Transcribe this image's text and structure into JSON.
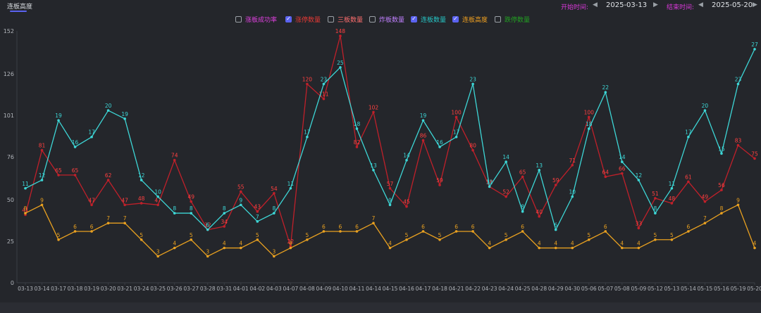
{
  "header": {
    "tab_label": "连板高度",
    "start_label": "开始时间:",
    "start_date": "2025-03-13",
    "end_label": "结束时间:",
    "end_date": "2025-05-20",
    "prev_icon": "caret-left-icon",
    "next_icon": "caret-right-icon"
  },
  "legend": [
    {
      "label": "涨板成功率",
      "checked": false,
      "color": "#e040e0"
    },
    {
      "label": "涨停数量",
      "checked": true,
      "color": "#e53935"
    },
    {
      "label": "三板数量",
      "checked": false,
      "color": "#ff6e6e"
    },
    {
      "label": "炸板数量",
      "checked": false,
      "color": "#c080ff"
    },
    {
      "label": "连板数量",
      "checked": true,
      "color": "#26c6c6"
    },
    {
      "label": "连板高度",
      "checked": true,
      "color": "#f0a020"
    },
    {
      "label": "跌停数量",
      "checked": false,
      "color": "#22a022"
    }
  ],
  "colors": {
    "red": "#c0202a",
    "red_label": "#ff4040",
    "cyan": "#3dd6d6",
    "orange": "#e8a020",
    "grid": "#3a3d44",
    "axis_text": "#b0b4ba"
  },
  "chart_data": {
    "type": "line",
    "yticks": [
      0,
      25,
      50,
      76,
      101,
      126,
      152
    ],
    "ylim": [
      0,
      152
    ],
    "categories": [
      "03-13",
      "03-14",
      "03-17",
      "03-18",
      "03-19",
      "03-20",
      "03-21",
      "03-24",
      "03-25",
      "03-26",
      "03-27",
      "03-28",
      "03-31",
      "04-01",
      "04-02",
      "04-03",
      "04-07",
      "04-08",
      "04-09",
      "04-10",
      "04-11",
      "04-14",
      "04-15",
      "04-16",
      "04-17",
      "04-18",
      "04-21",
      "04-22",
      "04-23",
      "04-24",
      "04-25",
      "04-28",
      "04-29",
      "04-30",
      "05-06",
      "05-07",
      "05-08",
      "05-09",
      "05-12",
      "05-13",
      "05-14",
      "05-15",
      "05-16",
      "05-19",
      "05-20"
    ],
    "series": [
      {
        "name": "涨停数量",
        "color": "#c0202a",
        "label_color": "#ff4040",
        "values": [
          41,
          80,
          65,
          65,
          47,
          62,
          47,
          48,
          47,
          74,
          49,
          32,
          34,
          55,
          43,
          54,
          22,
          120,
          111,
          149,
          82,
          103,
          57,
          46,
          86,
          59,
          100,
          80,
          58,
          52,
          64,
          40,
          59,
          71,
          100,
          64,
          66,
          33,
          51,
          48,
          61,
          49,
          56,
          83,
          75
        ],
        "labels": [
          "41",
          "81",
          "65",
          "65",
          "47",
          "62",
          "47",
          "48",
          "47",
          "74",
          "49",
          "32",
          "34",
          "55",
          "43",
          "54",
          "22",
          "120",
          "111",
          "148",
          "82",
          "102",
          "57",
          "45",
          "86",
          "59",
          "100",
          "80",
          "58",
          "52",
          "65",
          "40",
          "59",
          "71",
          "100",
          "64",
          "66",
          "33",
          "51",
          "48",
          "61",
          "49",
          "56",
          "83",
          "75"
        ]
      },
      {
        "name": "连板数量",
        "color": "#3dd6d6",
        "label_color": "#3dd6d6",
        "values": [
          57,
          62,
          98,
          82,
          88,
          104,
          99,
          62,
          52,
          42,
          42,
          32,
          42,
          47,
          37,
          42,
          57,
          88,
          120,
          130,
          93,
          68,
          47,
          74,
          98,
          82,
          88,
          120,
          58,
          73,
          43,
          68,
          32,
          52,
          93,
          115,
          73,
          62,
          42,
          57,
          88,
          104,
          78,
          120,
          141
        ],
        "labels": [
          "11",
          "12",
          "19",
          "16",
          "17",
          "20",
          "19",
          "12",
          "10",
          "8",
          "8",
          "6",
          "8",
          "9",
          "7",
          "8",
          "11",
          "17",
          "23",
          "25",
          "18",
          "13",
          "9",
          "14",
          "19",
          "16",
          "17",
          "23",
          "11",
          "14",
          "8",
          "13",
          "6",
          "10",
          "18",
          "22",
          "14",
          "12",
          "8",
          "11",
          "17",
          "20",
          "15",
          "23",
          "27"
        ]
      },
      {
        "name": "连板高度",
        "color": "#e8a020",
        "label_color": "#e8a020",
        "values": [
          42,
          47,
          26,
          31,
          31,
          36,
          36,
          26,
          16,
          21,
          26,
          16,
          21,
          21,
          26,
          16,
          21,
          26,
          31,
          31,
          31,
          36,
          21,
          26,
          31,
          26,
          31,
          31,
          21,
          26,
          31,
          21,
          21,
          21,
          26,
          31,
          21,
          21,
          26,
          26,
          31,
          36,
          42,
          47,
          21
        ],
        "labels": [
          "8",
          "9",
          "5",
          "6",
          "6",
          "7",
          "7",
          "5",
          "3",
          "4",
          "5",
          "3",
          "4",
          "4",
          "5",
          "3",
          "4",
          "5",
          "6",
          "6",
          "6",
          "7",
          "4",
          "5",
          "6",
          "5",
          "6",
          "6",
          "4",
          "5",
          "6",
          "4",
          "4",
          "4",
          "5",
          "6",
          "4",
          "4",
          "5",
          "5",
          "6",
          "7",
          "8",
          "9",
          "4"
        ]
      }
    ]
  }
}
